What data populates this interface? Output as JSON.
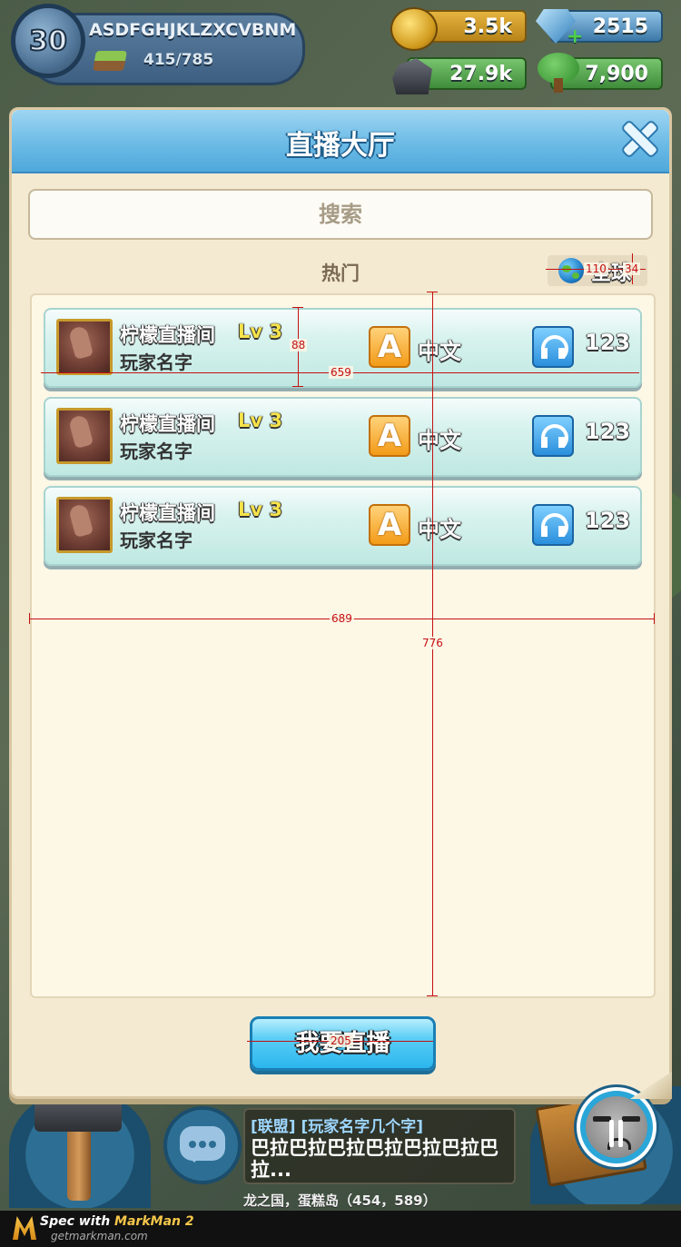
{
  "hud": {
    "level": "30",
    "player_name": "ASDFGHJKLZXCVBNM",
    "xp": "415/785",
    "gold": "3.5k",
    "gems": "2515",
    "gem_plus": "+",
    "stone": "27.9k",
    "wood": "7,900"
  },
  "dialog": {
    "title": "直播大厅",
    "search_placeholder": "搜索",
    "section_title": "热门",
    "region_label": "全球",
    "go_live_label": "我要直播"
  },
  "rooms": [
    {
      "name": "柠檬直播间",
      "level": "Lv 3",
      "player": "玩家名字",
      "lang_letter": "A",
      "language": "中文",
      "listeners": "123"
    },
    {
      "name": "柠檬直播间",
      "level": "Lv 3",
      "player": "玩家名字",
      "lang_letter": "A",
      "language": "中文",
      "listeners": "123"
    },
    {
      "name": "柠檬直播间",
      "level": "Lv 3",
      "player": "玩家名字",
      "lang_letter": "A",
      "language": "中文",
      "listeners": "123"
    }
  ],
  "chat": {
    "tag": "[联盟] [玩家名字几个字]",
    "message": "巴拉巴拉巴拉巴拉巴拉巴拉巴拉...",
    "location": "龙之国，蛋糕岛（454，589）"
  },
  "footer": {
    "brand_prefix": "Spec with ",
    "brand_name": "MarkMan 2",
    "url": "getmarkman.com"
  },
  "spec_marks": {
    "card_height": "88",
    "card_width": "659",
    "list_width": "689",
    "list_height": "776",
    "region_width": "110",
    "region_height": "34",
    "button_width": "205"
  },
  "colors": {
    "header_blue": "#6cbbe6",
    "panel_bg": "#f4ead2",
    "card_teal": "#d9f3ef",
    "lang_orange": "#f39b18",
    "listener_blue": "#2b8fdc",
    "level_yellow": "#f6e24a",
    "spec_red": "#c41111"
  },
  "icons": [
    "close-icon",
    "globe-icon",
    "headphones-icon",
    "coin-icon",
    "gem-icon",
    "stone-icon",
    "tree-icon",
    "chat-icon",
    "hammer-icon",
    "face-icon"
  ]
}
